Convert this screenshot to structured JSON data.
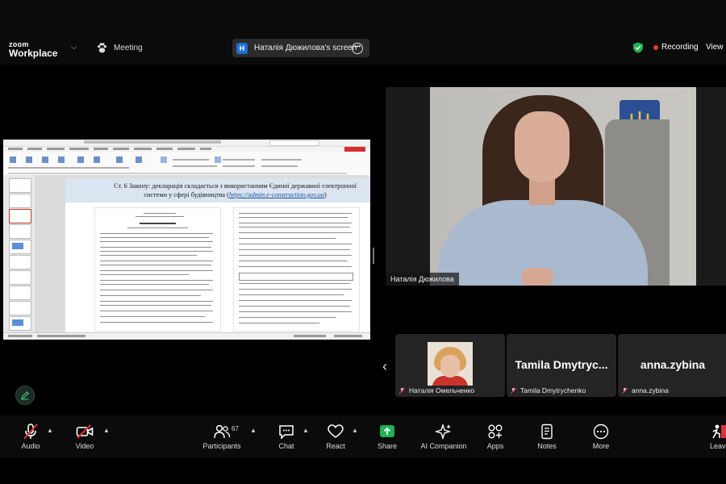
{
  "app": {
    "logo_line1": "zoom",
    "logo_line2": "Workplace",
    "meeting_label": "Meeting",
    "share_badge": "H",
    "share_title": "Наталія Дюжилова's screen",
    "recording_label": "Recording",
    "view_label": "View"
  },
  "slide": {
    "title_main": "Ст. 6 Закону: декларація складається з використанням Єдиної державної електронної системи у сфері будівництва (",
    "title_url": "https://admin.e-construction.gov.ua",
    "title_end": ")"
  },
  "speaker": {
    "name": "Наталія Дюжилова"
  },
  "gallery": [
    {
      "name": "Наталія Омельченко",
      "big": ""
    },
    {
      "name": "Tamila Dmytrychenko",
      "big": "Tamila  Dmytryc..."
    },
    {
      "name": "anna.zybina",
      "big": "anna.zybina"
    }
  ],
  "toolbar": {
    "audio": "Audio",
    "video": "Video",
    "participants": "Participants",
    "participants_count": "67",
    "chat": "Chat",
    "react": "React",
    "share": "Share",
    "ai": "AI Companion",
    "apps": "Apps",
    "notes": "Notes",
    "more": "More",
    "leave": "Leave"
  },
  "colors": {
    "share_green": "#1fb153",
    "record_red": "#e53935",
    "mute_red": "#e0303a",
    "zoom_blue": "#1f6fd1"
  }
}
